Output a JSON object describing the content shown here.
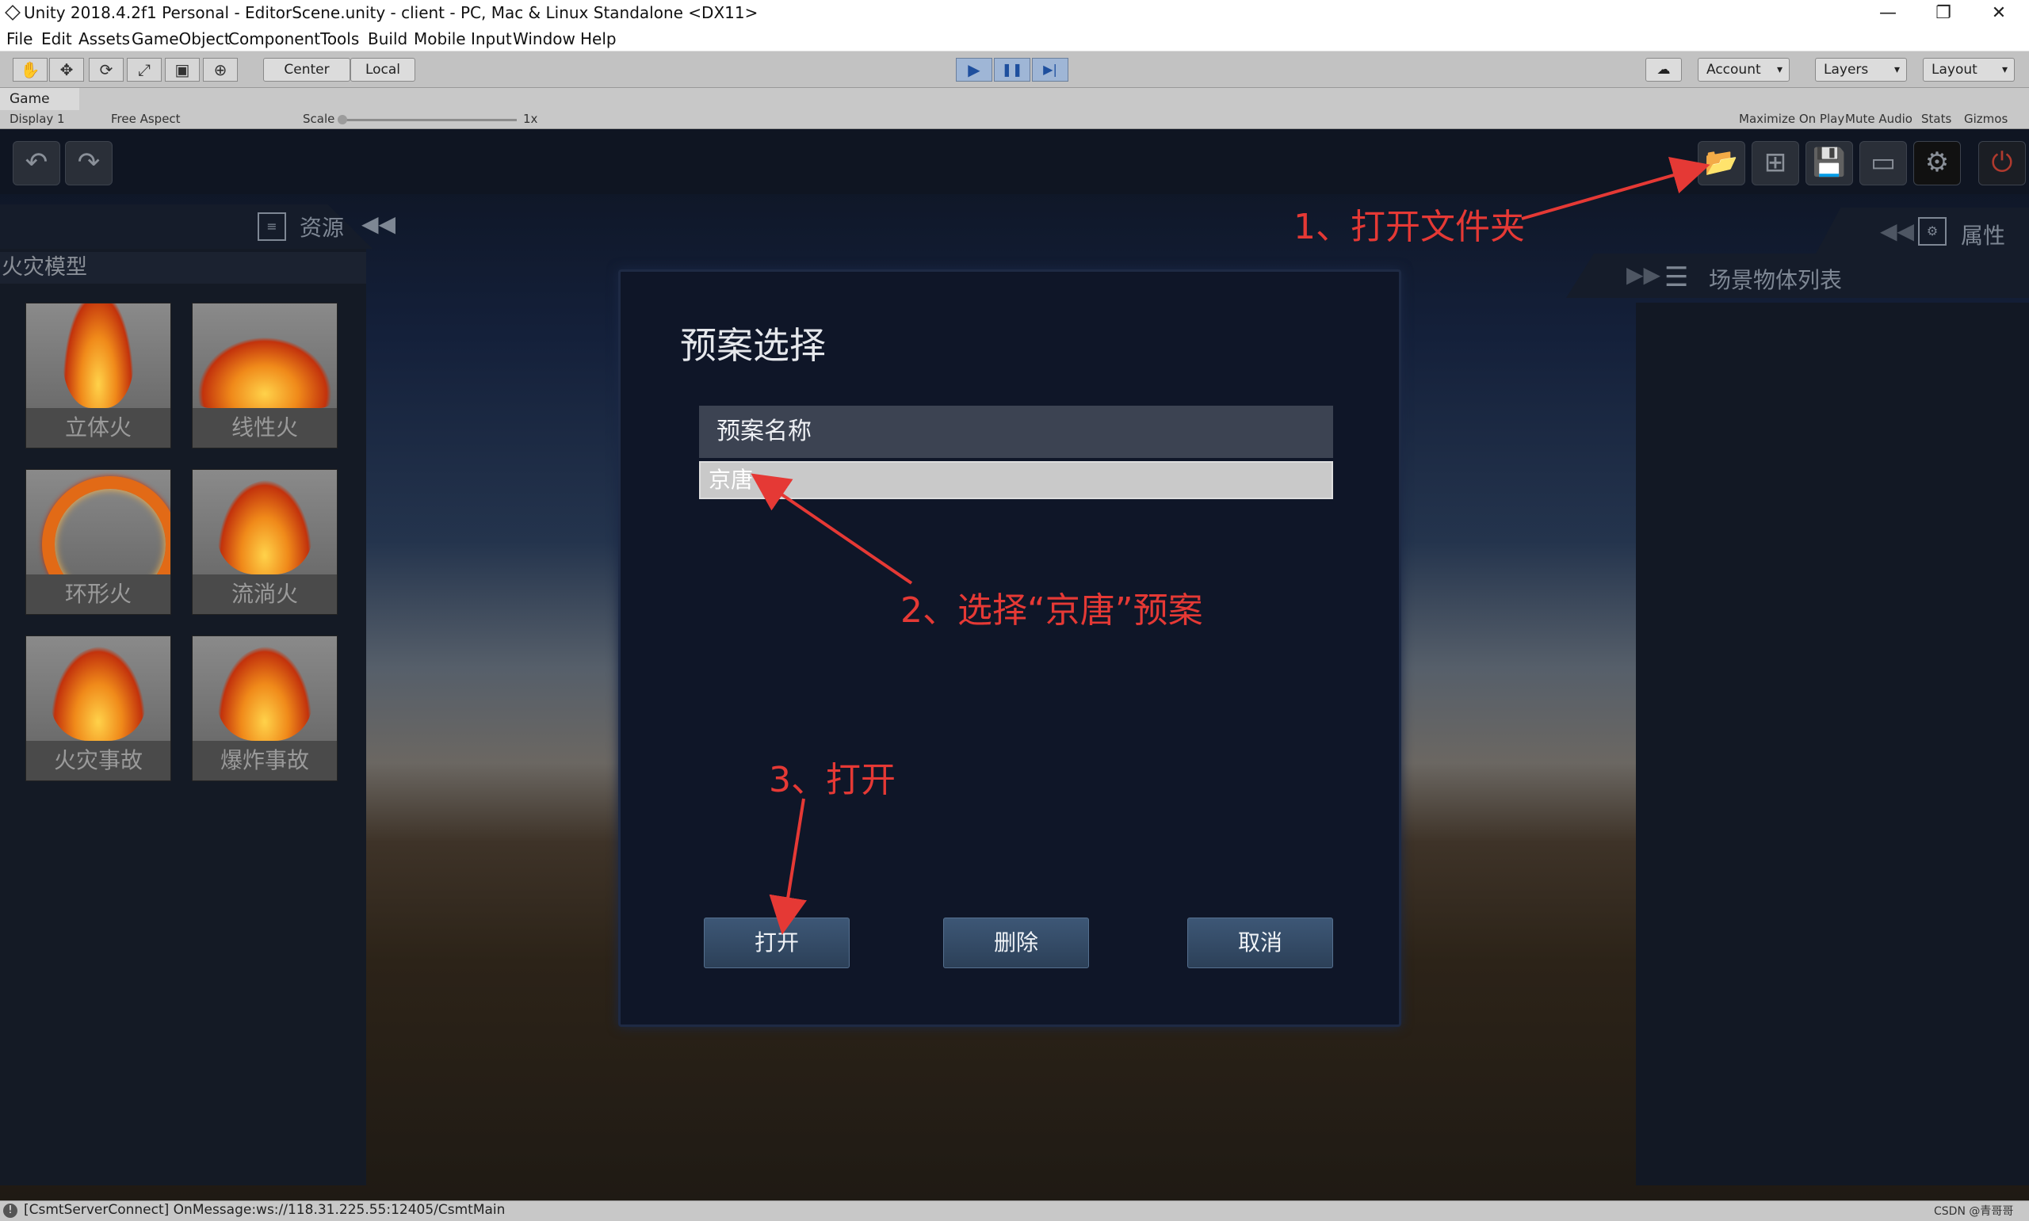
{
  "window": {
    "title": "Unity 2018.4.2f1 Personal - EditorScene.unity - client - PC, Mac & Linux Standalone <DX11>",
    "minimize_icon": "—",
    "restore_icon": "❐",
    "close_icon": "✕"
  },
  "menu": [
    "File",
    "Edit",
    "Assets",
    "GameObject",
    "Component",
    "Tools",
    "Build",
    "Mobile Input",
    "Window",
    "Help"
  ],
  "toolbar": {
    "tool_icons": [
      "✋",
      "✥",
      "⟳",
      "⤢",
      "▣",
      "⊕"
    ],
    "pivot_label": "Center",
    "space_label": "Local",
    "play_icon": "▶",
    "pause_icon": "❚❚",
    "step_icon": "▶|",
    "cloud_icon": "☁",
    "account_label": "Account",
    "layers_label": "Layers",
    "layout_label": "Layout"
  },
  "game_view": {
    "tab_label": "Game",
    "display_label": "Display 1",
    "aspect_label": "Free Aspect",
    "scale_label": "Scale",
    "scale_value": "1x",
    "maximize_label": "Maximize On Play",
    "mute_label": "Mute Audio",
    "stats_label": "Stats",
    "gizmos_label": "Gizmos"
  },
  "app": {
    "undo_icon": "↶",
    "redo_icon": "↷",
    "top_buttons": [
      "📂",
      "⊞",
      "💾",
      "▭",
      "⚙",
      "⏻"
    ],
    "left_panel": {
      "header_label": "资源",
      "header_icon": "≡",
      "collapse_icon": "◀◀",
      "category": "火灾模型",
      "items": [
        "立体火",
        "线性火",
        "环形火",
        "流淌火",
        "火灾事故",
        "爆炸事故"
      ]
    },
    "right_panel": {
      "props_label": "属性",
      "props_icon": "⚙",
      "props_collapse_icon": "◀◀",
      "scene_label": "场景物体列表",
      "scene_icon": "☰",
      "scene_expand_icon": "▶▶"
    },
    "dialog": {
      "title": "预案选择",
      "column_header": "预案名称",
      "rows": [
        "京唐"
      ],
      "open_button": "打开",
      "delete_button": "删除",
      "cancel_button": "取消"
    }
  },
  "annotations": {
    "step1": "1、打开文件夹",
    "step2": "2、选择“京唐”预案",
    "step3": "3、打开",
    "color": "#e53935"
  },
  "status": {
    "message": "[CsmtServerConnect] OnMessage:ws://118.31.225.55:12405/CsmtMain",
    "watermark": "CSDN @青哥哥"
  }
}
